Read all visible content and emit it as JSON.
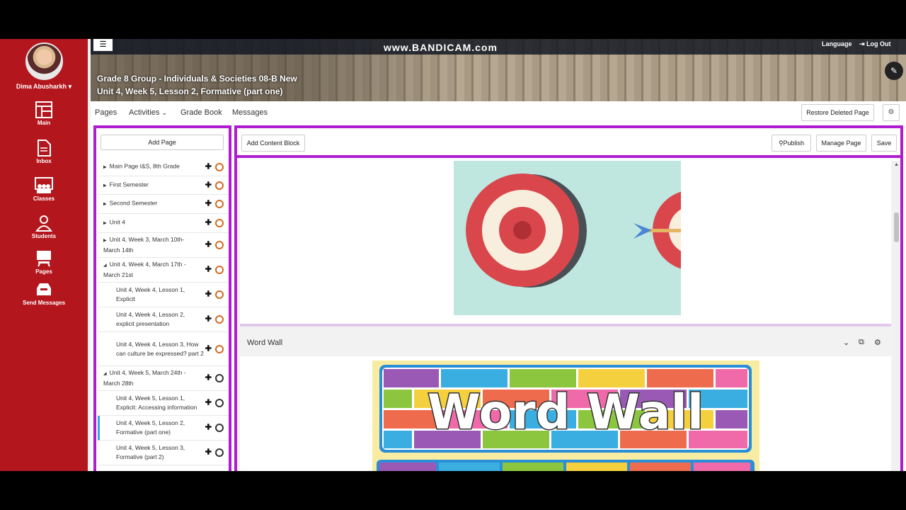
{
  "sidebar": {
    "user_name": "Dima Abusharkh",
    "items": [
      {
        "label": "Main",
        "icon": "main-icon"
      },
      {
        "label": "Inbox",
        "icon": "inbox-icon"
      },
      {
        "label": "Classes",
        "icon": "classes-icon"
      },
      {
        "label": "Students",
        "icon": "students-icon"
      },
      {
        "label": "Pages",
        "icon": "pages-icon"
      },
      {
        "label": "Send Messages",
        "icon": "send-messages-icon"
      }
    ],
    "color": "#b3171d"
  },
  "header": {
    "watermark": "www.BANDICAM.com",
    "language": "Language",
    "logout": "Log Out",
    "course_line1": "Grade 8 Group - Individuals & Societies 08-B New",
    "course_line2": "Unit 4, Week 5, Lesson 2, Formative (part one)"
  },
  "topnav": {
    "pages": "Pages",
    "activities": "Activities",
    "gradebook": "Grade Book",
    "messages": "Messages",
    "restore": "Restore Deleted Page"
  },
  "pagelist": {
    "add_page": "Add Page",
    "items": [
      {
        "label": "Main Page I&S, 8th Grade"
      },
      {
        "label": "First Semester"
      },
      {
        "label": "Second Semester"
      },
      {
        "label": "Unit 4"
      },
      {
        "label": "Unit 4, Week 3, March 10th-March 14th"
      },
      {
        "label": "Unit 4, Week 4, March 17th - March 21st"
      },
      {
        "label": "Unit 4, Week 4, Lesson 1, Explicit"
      },
      {
        "label": "Unit 4, Week 4, Lesson 2, explicit presentation"
      },
      {
        "label": "Unit 4, Week 4, Lesson 3, How can culture be expressed? part 2"
      },
      {
        "label": "Unit 4, Week 5, March 24th - March 28th"
      },
      {
        "label": "Unit 4, Week 5, Lesson 1, Explicit: Accessing information"
      },
      {
        "label": "Unit 4, Week 5, Lesson 2, Formative (part one)"
      },
      {
        "label": "Unit 4, Week 5, Lesson 3, Formative (part 2)"
      }
    ],
    "accent": "#b01dd0"
  },
  "editor": {
    "add_content_block": "Add Content Block",
    "publish": "Publish",
    "manage_page": "Manage Page",
    "save": "Save",
    "block2_title": "Word Wall",
    "wordwall_text": "Word Wall"
  }
}
